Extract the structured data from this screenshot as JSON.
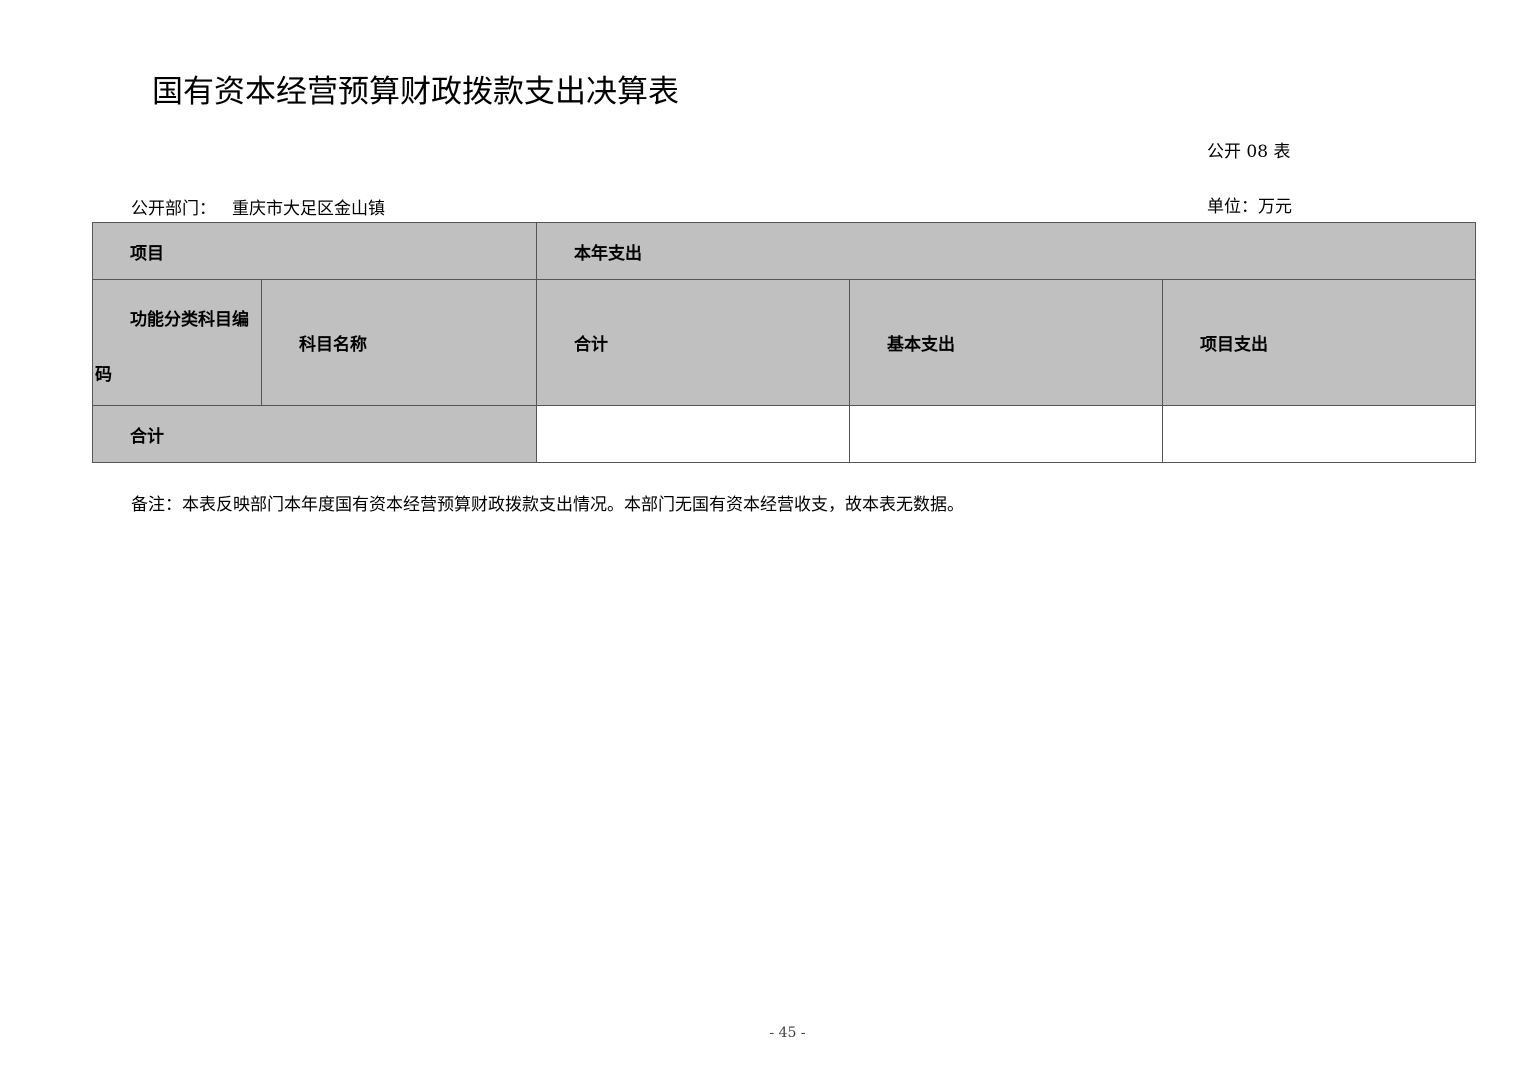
{
  "document": {
    "title": "国有资本经营预算财政拨款支出决算表",
    "table_no": "公开 08 表",
    "dept_label": "公开部门：",
    "dept_value": "重庆市大足区金山镇",
    "unit": "单位：万元"
  },
  "table": {
    "header_row1": {
      "item": "项目",
      "current_year": "本年支出"
    },
    "header_row2": {
      "code_line1": "功能分类科目编",
      "code_line2": "码",
      "subject_name": "科目名称",
      "total": "合计",
      "basic": "基本支出",
      "project": "项目支出"
    },
    "total_row": {
      "label": "合计",
      "total": "",
      "basic": "",
      "project": ""
    }
  },
  "note": "备注：本表反映部门本年度国有资本经营预算财政拨款支出情况。本部门无国有资本经营收支，故本表无数据。",
  "page_number": "- 45 -"
}
